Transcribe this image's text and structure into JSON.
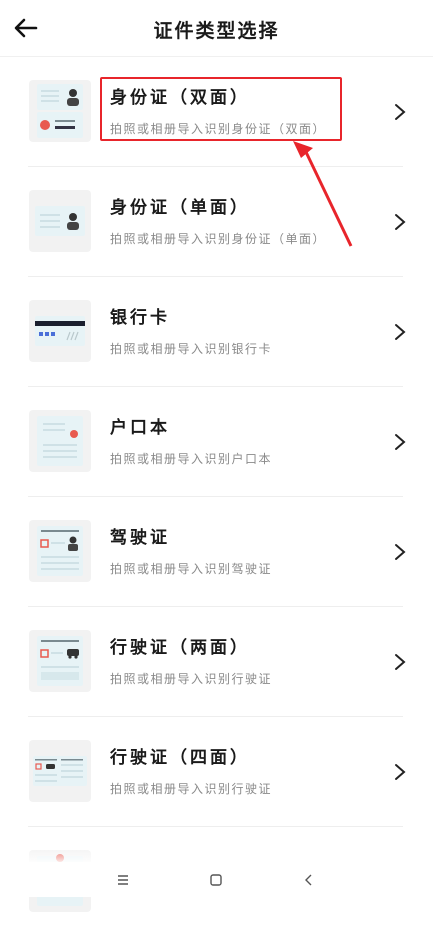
{
  "header": {
    "title": "证件类型选择"
  },
  "items": [
    {
      "title": "身份证（双面）",
      "subtitle": "拍照或相册导入识别身份证（双面）"
    },
    {
      "title": "身份证（单面）",
      "subtitle": "拍照或相册导入识别身份证（单面）"
    },
    {
      "title": "银行卡",
      "subtitle": "拍照或相册导入识别银行卡"
    },
    {
      "title": "户口本",
      "subtitle": "拍照或相册导入识别户口本"
    },
    {
      "title": "驾驶证",
      "subtitle": "拍照或相册导入识别驾驶证"
    },
    {
      "title": "行驶证（两面）",
      "subtitle": "拍照或相册导入识别行驶证"
    },
    {
      "title": "行驶证（四面）",
      "subtitle": "拍照或相册导入识别行驶证"
    },
    {
      "title": "",
      "subtitle": ""
    }
  ],
  "colors": {
    "highlight": "#e8252b",
    "accent_blue": "#4a6fd8"
  }
}
